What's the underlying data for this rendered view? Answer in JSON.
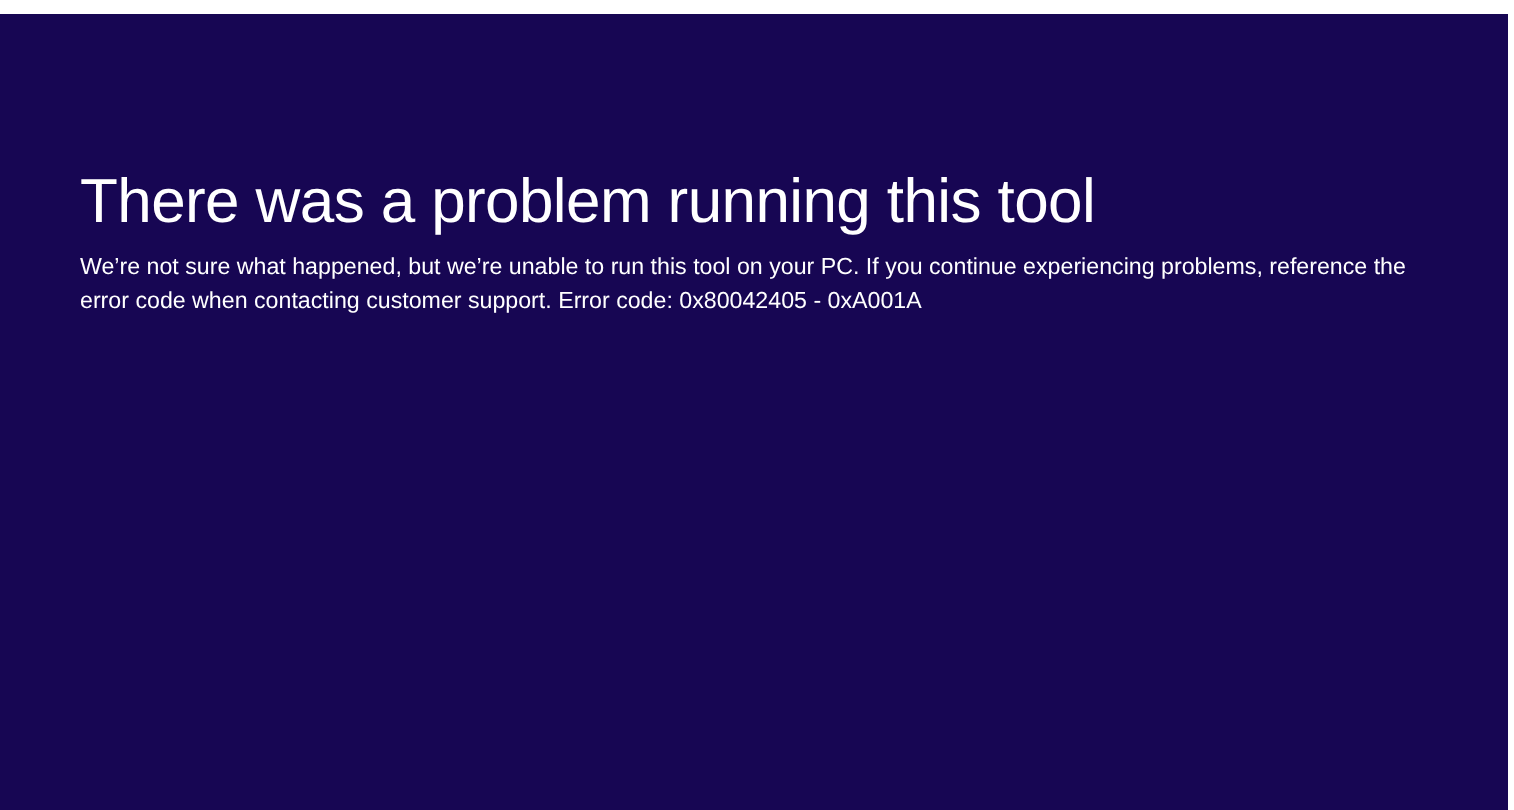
{
  "title": "There was a problem running this tool",
  "message": "We’re not sure what happened, but we’re unable to run this tool on your PC. If you continue experiencing problems, reference the error code when contacting customer support. Error code: 0x80042405 - 0xA001A"
}
